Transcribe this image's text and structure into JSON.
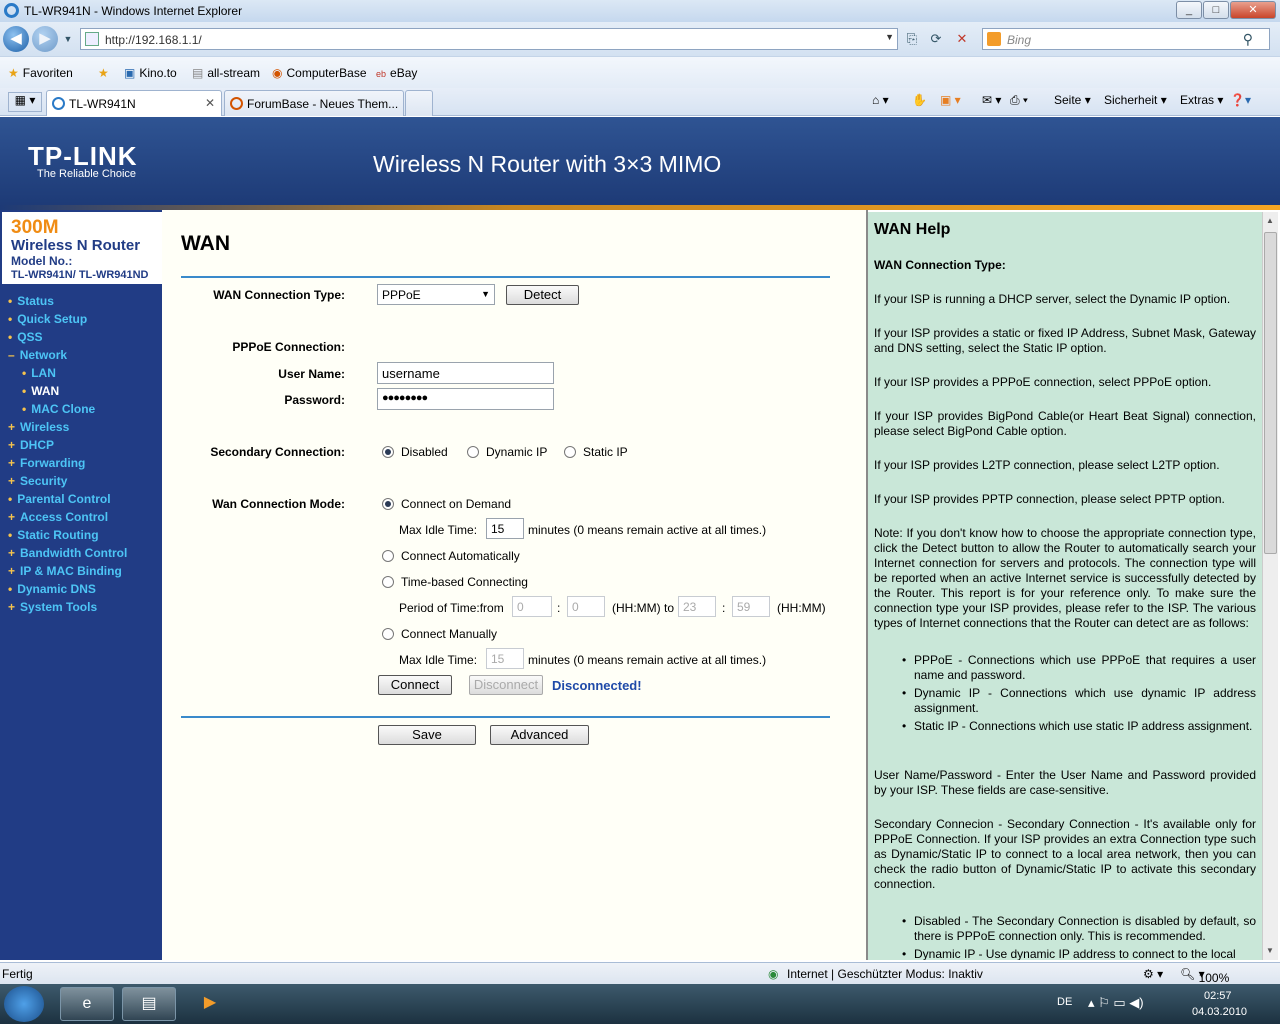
{
  "browser": {
    "window_title": "TL-WR941N - Windows Internet Explorer",
    "url": "http://192.168.1.1/",
    "search_placeholder": "Bing",
    "favorites_label": "Favoriten",
    "favorites": [
      "Kino.to",
      "all-stream",
      "ComputerBase",
      "eBay"
    ],
    "tabs": [
      "TL-WR941N",
      "ForumBase - Neues Them..."
    ],
    "commands": [
      "Seite",
      "Sicherheit",
      "Extras"
    ],
    "status_left": "Fertig",
    "status_zone": "Internet | Geschützter Modus: Inaktiv",
    "zoom": "100%"
  },
  "router": {
    "brand": "TP-LINK",
    "slogan": "The Reliable Choice",
    "product_title": "Wireless N Router with 3×3 MIMO",
    "sidebar_header": {
      "speed": "300M",
      "name": "Wireless N Router",
      "model_label": "Model No.:",
      "model": "TL-WR941N/ TL-WR941ND"
    },
    "menu": [
      "Status",
      "Quick Setup",
      "QSS",
      "Network",
      "LAN",
      "WAN",
      "MAC Clone",
      "Wireless",
      "DHCP",
      "Forwarding",
      "Security",
      "Parental Control",
      "Access Control",
      "Static Routing",
      "Bandwidth Control",
      "IP & MAC Binding",
      "Dynamic DNS",
      "System Tools"
    ],
    "active_menu": "WAN"
  },
  "form": {
    "title": "WAN",
    "wan_type_label": "WAN Connection Type:",
    "wan_type_value": "PPPoE",
    "detect_button": "Detect",
    "pppoe_heading": "PPPoE Connection:",
    "username_label": "User Name:",
    "username_value": "username",
    "password_label": "Password:",
    "password_mask": "●●●●●●●●",
    "secondary_label": "Secondary Connection:",
    "secondary_options": [
      "Disabled",
      "Dynamic IP",
      "Static IP"
    ],
    "secondary_selected": "Disabled",
    "mode_label": "Wan Connection Mode:",
    "mode_options": [
      "Connect on Demand",
      "Connect Automatically",
      "Time-based Connecting",
      "Connect Manually"
    ],
    "mode_selected": "Connect on Demand",
    "max_idle_label": "Max Idle Time:",
    "max_idle_value": "15",
    "max_idle_suffix": "minutes (0 means remain active at all times.)",
    "period_label": "Period of Time:from",
    "period_from_h": "0",
    "period_from_m": "0",
    "period_to_h": "23",
    "period_to_m": "59",
    "colon": ":",
    "hhmm_to": "(HH:MM) to",
    "hhmm": "(HH:MM)",
    "max_idle_value_2": "15",
    "connect_button": "Connect",
    "disconnect_button": "Disconnect",
    "status_text": "Disconnected!",
    "save_button": "Save",
    "advanced_button": "Advanced"
  },
  "help": {
    "title": "WAN Help",
    "conn_type_heading": "WAN Connection Type:",
    "p1": "If your ISP is running a DHCP server, select the Dynamic IP option.",
    "p2": "If your ISP provides a static or fixed IP Address, Subnet Mask, Gateway and DNS setting, select the Static IP option.",
    "p3": "If your ISP provides a PPPoE connection, select PPPoE option.",
    "p4": "If your ISP provides BigPond Cable(or Heart Beat Signal) connection, please select BigPond Cable option.",
    "p5": "If your ISP provides L2TP connection, please select L2TP option.",
    "p6": "If your ISP provides PPTP connection, please select PPTP option.",
    "note": "Note: If you don't know how to choose the appropriate connection type, click the Detect button to allow the Router to automatically search your Internet connection for servers and protocols. The connection type will be reported when an active Internet service is successfully detected by the Router. This report is for your reference only. To make sure the connection type your ISP provides, please refer to the ISP. The various types of Internet connections that the Router can detect are as follows:",
    "b1": "PPPoE - Connections which use PPPoE that requires a user name and password.",
    "b2": "Dynamic IP - Connections which use dynamic IP address assignment.",
    "b3": "Static IP - Connections which use static IP address assignment.",
    "user_pass": "User Name/Password - Enter the User Name and Password provided by your ISP. These fields are case-sensitive.",
    "secondary": "Secondary Connecion - Secondary Connection - It's available only for PPPoE Connection. If your ISP provides an extra Connection type such as Dynamic/Static IP to connect to a local area network, then you can check the radio button of Dynamic/Static IP to activate this secondary connection.",
    "b4": "Disabled - The Secondary Connection is disabled by default, so there is PPPoE connection only. This is recommended.",
    "b5": "Dynamic IP - Use dynamic IP address to connect to the local"
  },
  "taskbar": {
    "lang": "DE",
    "time": "02:57",
    "date": "04.03.2010"
  }
}
